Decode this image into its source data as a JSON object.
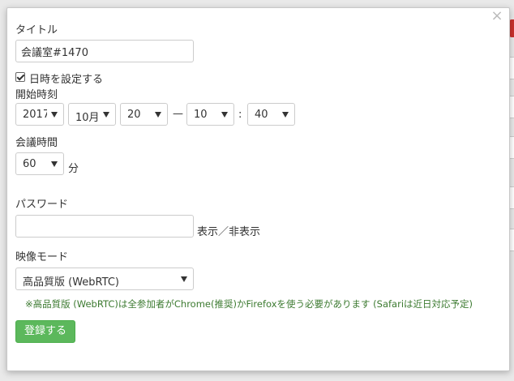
{
  "dialog": {
    "title_label": "タイトル",
    "title_value": "会議室#1470",
    "datetime_checkbox_label": "日時を設定する",
    "datetime_checked": true,
    "start_time_label": "開始時刻",
    "start": {
      "year": "2017",
      "month": "10月",
      "day": "20",
      "dash": "—",
      "hour": "10",
      "colon": ":",
      "minute": "40"
    },
    "duration_label": "会議時間",
    "duration_value": "60",
    "duration_unit": "分",
    "password_label": "パスワード",
    "password_value": "",
    "password_toggle": "表示／非表示",
    "video_mode_label": "映像モード",
    "video_mode_value": "高品質版 (WebRTC)",
    "note": "※高品質版 (WebRTC)は全参加者がChrome(推奨)かFirefoxを使う必要があります (Safariは近日対応予定)",
    "submit_label": "登録する",
    "close_glyph": "×"
  },
  "colors": {
    "submit_bg": "#5cb85c",
    "note_text": "#3c7a30"
  }
}
